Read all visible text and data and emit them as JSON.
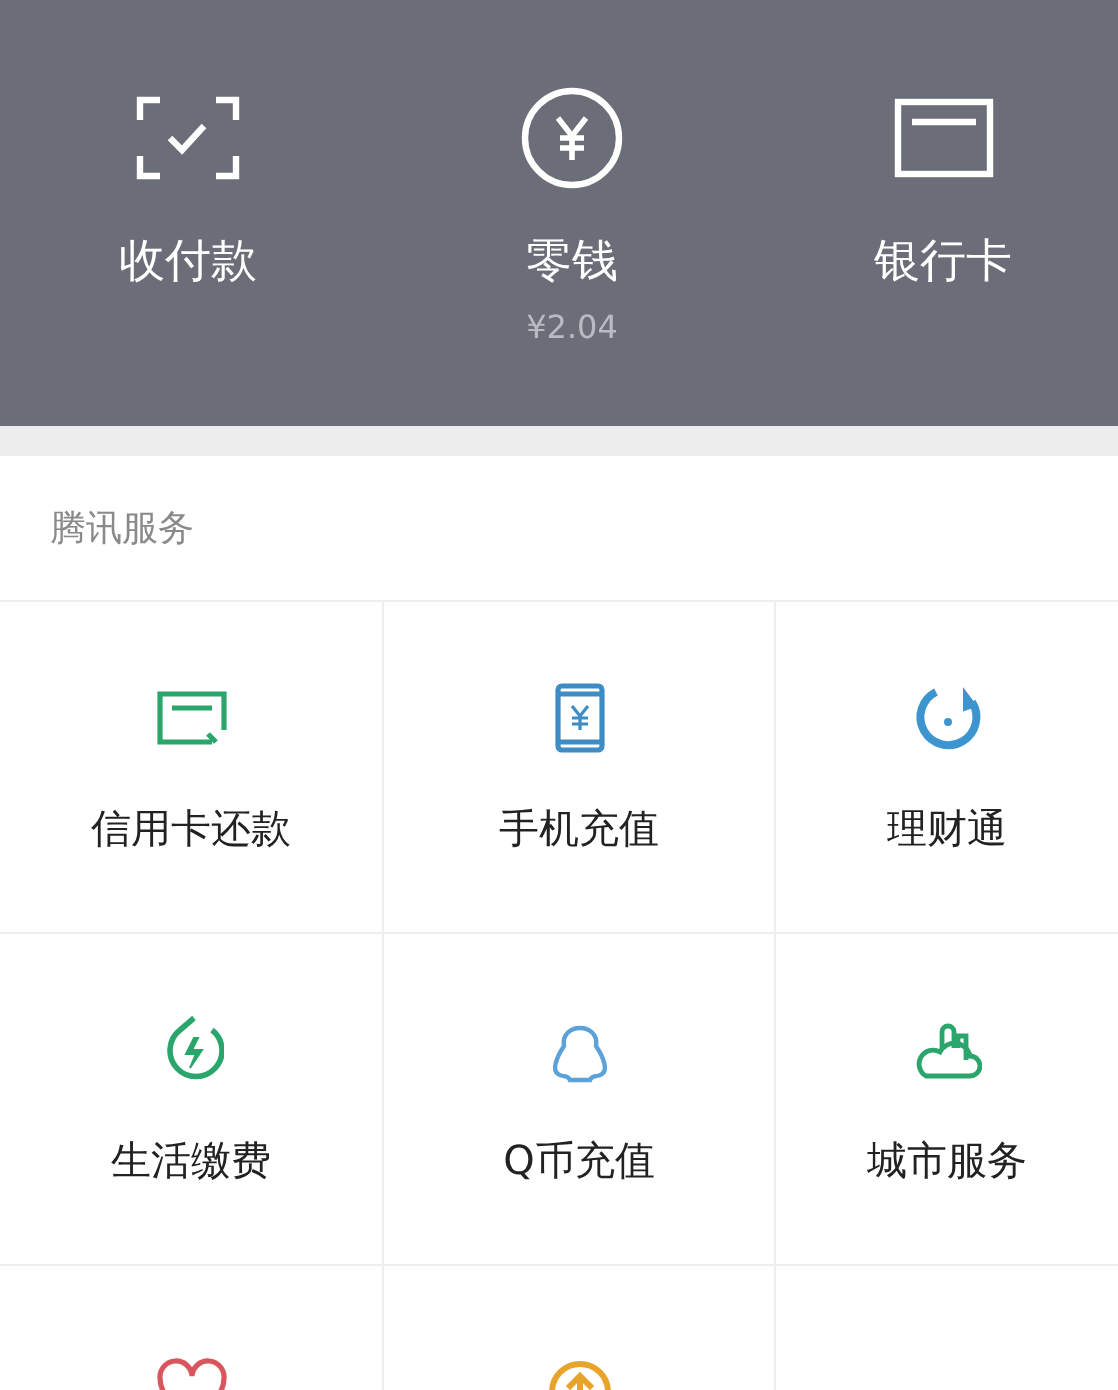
{
  "top_actions": [
    {
      "label": "收付款"
    },
    {
      "label": "零钱",
      "amount": "¥2.04"
    },
    {
      "label": "银行卡"
    }
  ],
  "section": {
    "title": "腾讯服务"
  },
  "services": [
    {
      "label": "信用卡还款"
    },
    {
      "label": "手机充值"
    },
    {
      "label": "理财通"
    },
    {
      "label": "生活缴费"
    },
    {
      "label": "Q币充值"
    },
    {
      "label": "城市服务"
    }
  ]
}
